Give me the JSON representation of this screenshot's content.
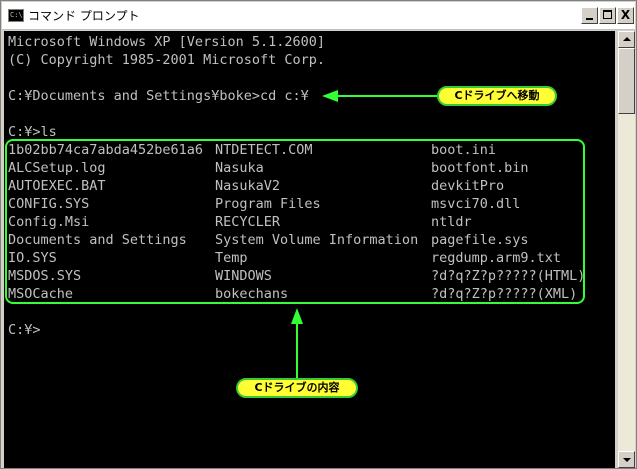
{
  "window": {
    "title": "コマンド プロンプト",
    "icon_text": "C:\\",
    "controls": [
      "minimize-icon",
      "maximize-icon",
      "close-icon"
    ],
    "close_glyph": "X"
  },
  "console": {
    "header_lines": [
      "Microsoft Windows XP [Version 5.1.2600]",
      "(C) Copyright 1985-2001 Microsoft Corp."
    ],
    "cd_command": "C:¥Documents and Settings¥boke>cd c:¥",
    "ls_command": "C:¥>ls",
    "listing": {
      "col1": [
        "1b02bb74ca7abda452be61a6",
        "ALCSetup.log",
        "AUTOEXEC.BAT",
        "CONFIG.SYS",
        "Config.Msi",
        "Documents and Settings",
        "IO.SYS",
        "MSDOS.SYS",
        "MSOCache"
      ],
      "col2": [
        "NTDETECT.COM",
        "Nasuka",
        "NasukaV2",
        "Program Files",
        "RECYCLER",
        "System Volume Information",
        "Temp",
        "WINDOWS",
        "bokechans"
      ],
      "col3": [
        "boot.ini",
        "bootfont.bin",
        "devkitPro",
        "msvci70.dll",
        "ntldr",
        "pagefile.sys",
        "regdump.arm9.txt",
        "?d?q?Z?p?????(HTML)",
        "?d?q?Z?p?????(XML)"
      ]
    },
    "final_prompt": "C:¥>"
  },
  "annotations": {
    "cd_label": "Cドライブへ移動",
    "content_label": "Cドライブの内容"
  },
  "colors": {
    "console_bg": "#000000",
    "console_text": "#c0c0c0",
    "annotation_green": "#33ff33",
    "callout_fill": "#ffff33"
  }
}
